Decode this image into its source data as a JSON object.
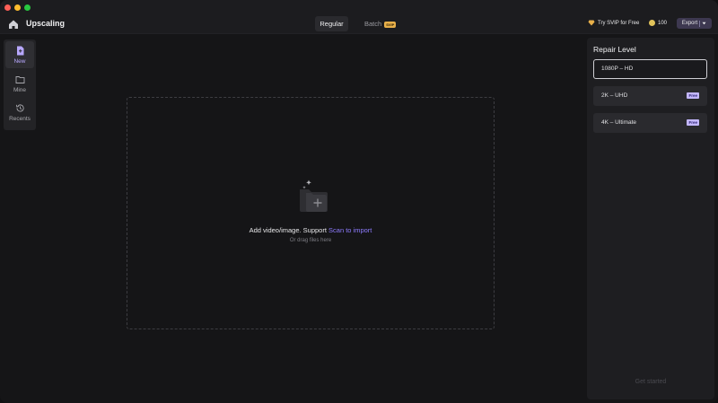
{
  "window": {
    "title": "Upscaling"
  },
  "tabs": [
    {
      "label": "Regular",
      "active": true
    },
    {
      "label": "Batch",
      "badge": "SVIP",
      "active": false
    }
  ],
  "header": {
    "try_svip": "Try SVIP for Free",
    "coins": "100",
    "export": "Export"
  },
  "sidebar": {
    "items": [
      {
        "label": "New",
        "icon": "new-file-icon",
        "active": true
      },
      {
        "label": "Mine",
        "icon": "folder-icon",
        "active": false
      },
      {
        "label": "Recents",
        "icon": "history-icon",
        "active": false
      }
    ]
  },
  "dropzone": {
    "main_text": "Add video/image. Support ",
    "link_text": "Scan to import",
    "sub_text": "Or drag files here"
  },
  "repair": {
    "title": "Repair Level",
    "options": [
      {
        "label": "1080P – HD",
        "selected": true,
        "badge": ""
      },
      {
        "label": "2K – UHD",
        "selected": false,
        "badge": "Free"
      },
      {
        "label": "4K – Ultimate",
        "selected": false,
        "badge": "Free"
      }
    ],
    "get_started": "Get started"
  },
  "colors": {
    "accent": "#8e7cff",
    "background": "#151517",
    "panel": "#1e1e21",
    "vip": "#e8b04a"
  }
}
